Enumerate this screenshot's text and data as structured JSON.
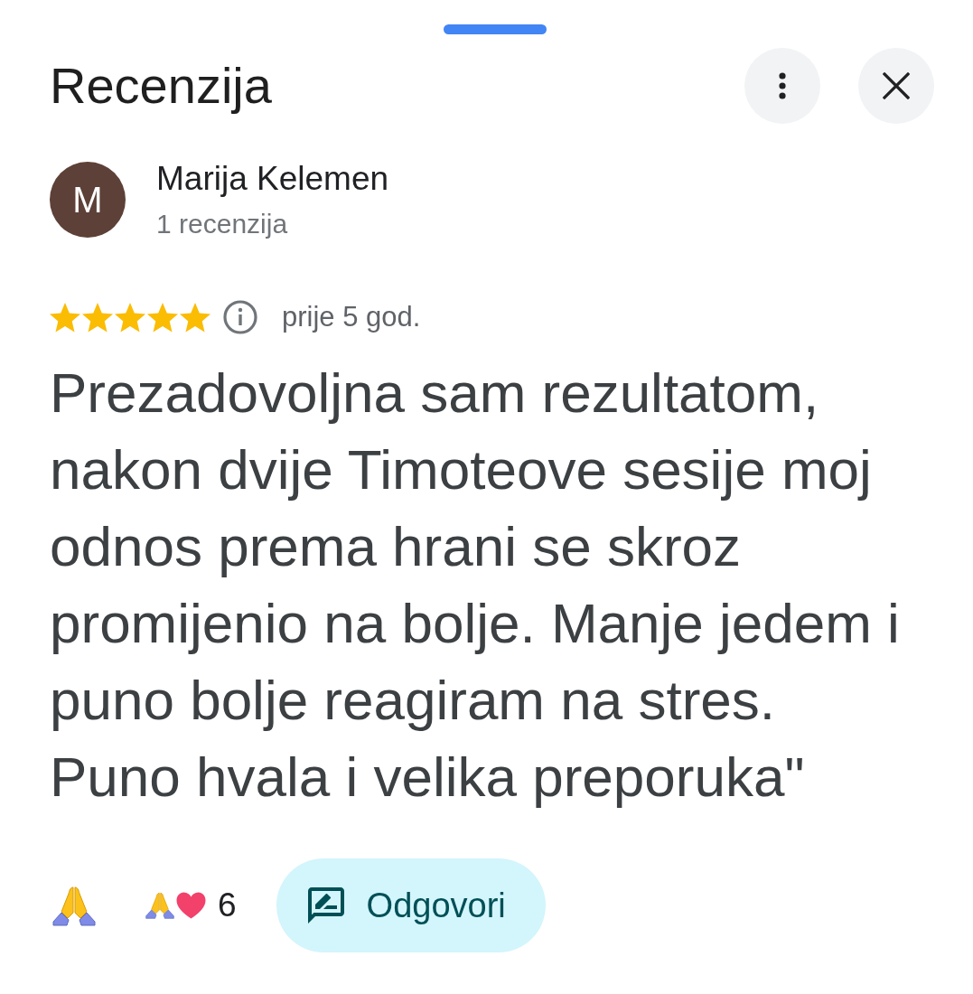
{
  "header": {
    "title": "Recenzija"
  },
  "reviewer": {
    "avatar_letter": "M",
    "name": "Marija Kelemen",
    "review_count": "1 recenzija"
  },
  "review": {
    "stars": 5,
    "time": "prije 5 god.",
    "text": "Prezadovoljna sam rezultatom, nakon dvije Timoteove sesije moj odnos prema hrani se skroz promijenio na bolje. Manje jedem i puno bolje reagiram na stres. Puno hvala i velika preporuka\""
  },
  "reactions": {
    "count": "6"
  },
  "reply_button": {
    "label": "Odgovori"
  }
}
